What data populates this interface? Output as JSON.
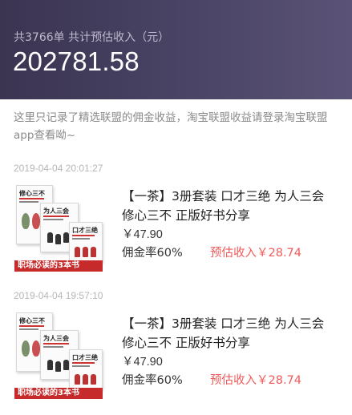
{
  "header": {
    "summary": "共3766单 共计预估收入（元）",
    "total": "202781.58"
  },
  "notice": "这里只记录了精选联盟的佣金收益，淘宝联盟收益请登录淘宝联盟app查看呦~",
  "orders": [
    {
      "timestamp": "2019-04-04 20:01:27",
      "title": "【一茶】3册套装 口才三绝 为人三会 修心三不 正版好书分享",
      "price": "￥47.90",
      "commission_rate": "佣金率60%",
      "estimated_income": "预估收入￥28.74",
      "thumb": {
        "book1": "修心三不",
        "book2": "为人三会",
        "book3": "口才三绝",
        "banner": "职场必读的3本书"
      }
    },
    {
      "timestamp": "2019-04-04 19:57:10",
      "title": "【一茶】3册套装 口才三绝 为人三会 修心三不 正版好书分享",
      "price": "￥47.90",
      "commission_rate": "佣金率60%",
      "estimated_income": "预估收入￥28.74",
      "thumb": {
        "book1": "修心三不",
        "book2": "为人三会",
        "book3": "口才三绝",
        "banner": "职场必读的3本书"
      }
    }
  ],
  "colors": {
    "header_bg": "#433d5c",
    "accent_red": "#f05a5a"
  }
}
